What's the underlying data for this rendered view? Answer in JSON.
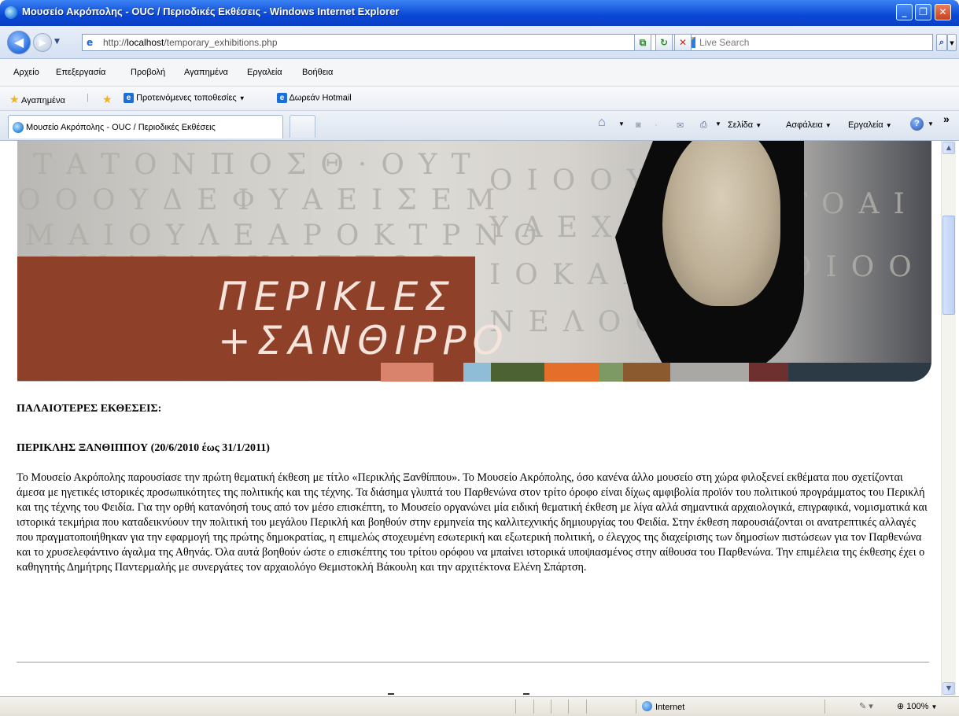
{
  "window": {
    "title": "Μουσείο Ακρόπολης - OUC / Περιοδικές Εκθέσεις - Windows Internet Explorer",
    "minimize": "_",
    "maximize": "❐",
    "close": "✕"
  },
  "address": {
    "url_prefix": "http://",
    "url_host": "localhost",
    "url_path": "/temporary_exhibitions.php",
    "search_placeholder": "Live Search"
  },
  "menu": [
    "Αρχείο",
    "Επεξεργασία",
    "Προβολή",
    "Αγαπημένα",
    "Εργαλεία",
    "Βοήθεια"
  ],
  "favorites": {
    "label": "Αγαπημένα",
    "suggested": "Προτεινόμενες τοποθεσίες",
    "hotmail": "Δωρεάν Hotmail"
  },
  "tab": {
    "title": "Μουσείο Ακρόπολης - OUC / Περιοδικές Εκθέσεις"
  },
  "commands": {
    "page": "Σελίδα",
    "safety": "Ασφάλεια",
    "tools": "Εργαλεία",
    "more": "»"
  },
  "banner": {
    "line1": "ΠΕΡΙΚLΕΣ",
    "line2": "+ΣΑΝΘΙΡΡΟ",
    "colors": [
      "#d9826c",
      "#8e4128",
      "#8fbcd6",
      "#4c6233",
      "#e46f2a",
      "#7d9a65",
      "#8b5a2e",
      "#aaa8a5",
      "#6e2f2f",
      "#2c3a46"
    ]
  },
  "article": {
    "older_heading": "ΠΑΛΑΙΟΤΕΡΕΣ ΕΚΘΕΣΕΙΣ:",
    "exhibit_heading": "ΠΕΡΙΚΛΗΣ ΞΑΝΘΙΠΠΟΥ (20/6/2010 έως 31/1/2011)",
    "body": "Το Μουσείο Ακρόπολης παρουσίασε την πρώτη θεματική έκθεση με τίτλο «Περικλής Ξανθίππου». Το Μουσείο Ακρόπολης, όσο κανένα άλλο μουσείο στη χώρα φιλοξενεί εκθέματα που σχετίζονται άμεσα με ηγετικές ιστορικές προσωπικότητες της πολιτικής και της τέχνης. Τα διάσημα γλυπτά του Παρθενώνα στον τρίτο όροφο είναι δίχως αμφιβολία προϊόν του πολιτικού προγράμματος του Περικλή και της τέχνης του Φειδία. Για την ορθή κατανόησή τους από τον μέσο επισκέπτη, το Μουσείο οργανώνει μία ειδική θεματική έκθεση με λίγα αλλά σημαντικά αρχαιολογικά, επιγραφικά, νομισματικά και ιστορικά τεκμήρια που καταδεικνύουν την πολιτική του μεγάλου Περικλή και βοηθούν στην ερμηνεία της καλλιτεχνικής δημιουργίας του Φειδία. Στην έκθεση παρουσιάζονται οι ανατρεπτικές αλλαγές που πραγματοποιήθηκαν για την εφαρμογή της πρώτης δημοκρατίας, η επιμελώς στοχευμένη εσωτερική και εξωτερική πολιτική, ο έλεγχος της διαχείρισης των δημοσίων πιστώσεων για τον Παρθενώνα και το χρυσελεφάντινο άγαλμα της Αθηνάς. Όλα αυτά βοηθούν ώστε ο επισκέπτης του τρίτου ορόφου να μπαίνει ιστορικά υποψιασμένος στην αίθουσα του Παρθενώνα. Την επιμέλεια της έκθεσης έχει ο καθηγητής Δημήτρης Παντερμαλής με συνεργάτες τον αρχαιολόγο Θεμιστοκλή Βάκουλη και την αρχιτέκτονα Ελένη Σπάρτση."
  },
  "status": {
    "zone": "Internet",
    "zoom": "100%"
  }
}
